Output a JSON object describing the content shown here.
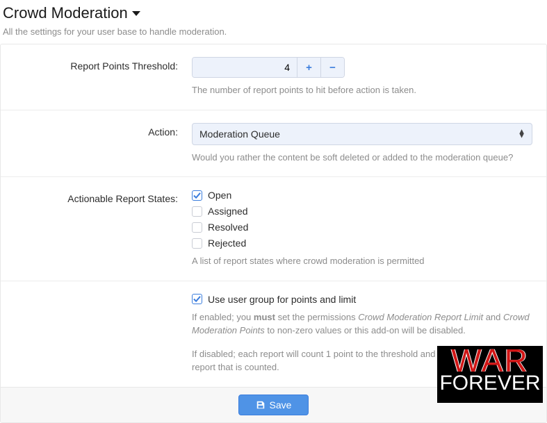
{
  "header": {
    "title": "Crowd Moderation",
    "subtitle": "All the settings for your user base to handle moderation."
  },
  "threshold": {
    "label": "Report Points Threshold:",
    "value": "4",
    "help": "The number of report points to hit before action is taken."
  },
  "action": {
    "label": "Action:",
    "selected": "Moderation Queue",
    "help": "Would you rather the content be soft deleted or added to the moderation queue?"
  },
  "states": {
    "label": "Actionable Report States:",
    "options": [
      {
        "label": "Open",
        "checked": true
      },
      {
        "label": "Assigned",
        "checked": false
      },
      {
        "label": "Resolved",
        "checked": false
      },
      {
        "label": "Rejected",
        "checked": false
      }
    ],
    "help": "A list of report states where crowd moderation is permitted"
  },
  "usergroup": {
    "label": "Use user group for points and limit",
    "checked": true,
    "help1_pre": "If enabled; you ",
    "help1_bold": "must",
    "help1_mid": " set the permissions ",
    "help1_em1": "Crowd Moderation Report Limit",
    "help1_and": " and ",
    "help1_em2": "Crowd Moderation Points",
    "help1_post": " to non-zero values or this add-on will be disabled.",
    "help2": "If disabled; each report will count 1 point to the threshold and a user may only have 1 report that is counted."
  },
  "footer": {
    "save": "Save"
  },
  "watermark": {
    "line1": "WAR",
    "line2": "FOREVER"
  }
}
